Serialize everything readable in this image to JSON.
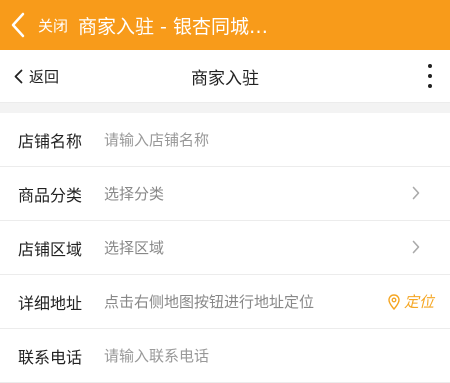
{
  "topbar": {
    "close_label": "关闭",
    "title": "商家入驻 - 银杏同城…",
    "background": "#f89b1a"
  },
  "navbar": {
    "back_label": "返回",
    "title": "商家入驻",
    "more_icon": "more-vertical-icon"
  },
  "form": {
    "store_name": {
      "label": "店铺名称",
      "placeholder": "请输入店铺名称"
    },
    "category": {
      "label": "商品分类",
      "value": "选择分类"
    },
    "region": {
      "label": "店铺区域",
      "value": "选择区域"
    },
    "address": {
      "label": "详细地址",
      "value": "点击右侧地图按钮进行地址定位",
      "locate_label": "定位"
    },
    "phone": {
      "label": "联系电话",
      "placeholder": "请输入联系电话"
    }
  }
}
